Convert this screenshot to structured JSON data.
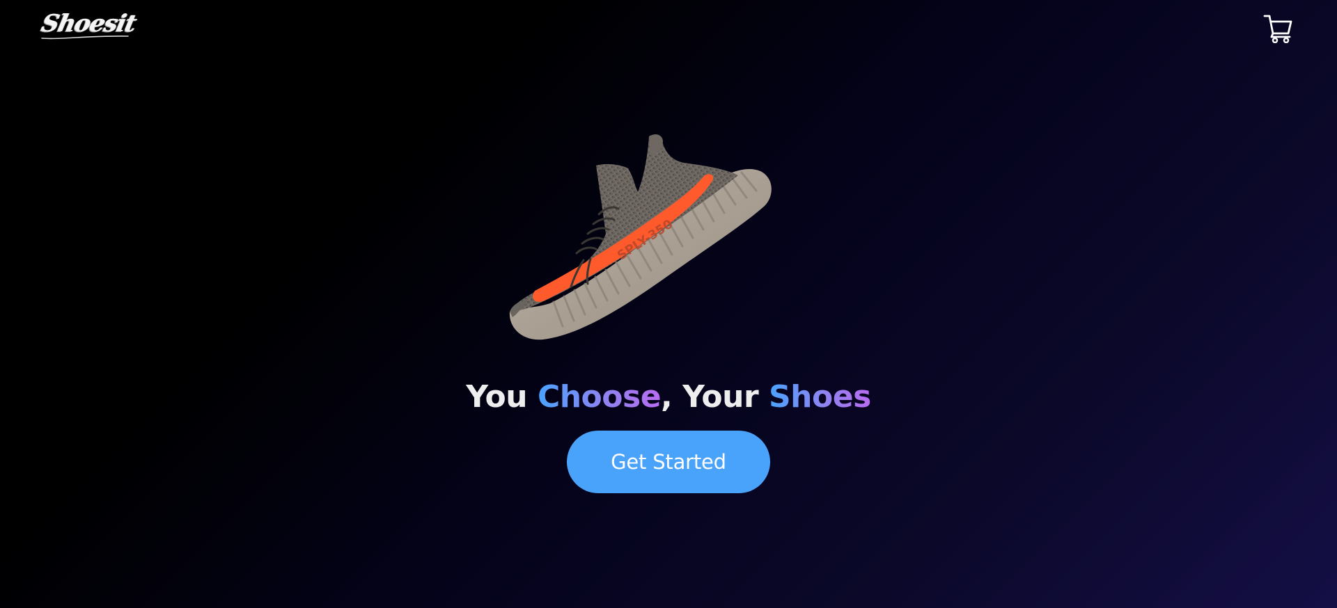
{
  "header": {
    "logo_text": "Shoesit",
    "cart_icon": "shopping-cart-icon"
  },
  "hero": {
    "image_icon": "sneaker-image",
    "shoe_tag_text": "SPLY-350",
    "headline": {
      "part1": "You ",
      "highlight1": "Choose",
      "part2": ", Your ",
      "highlight2": "Shoes"
    },
    "cta_label": "Get Started"
  },
  "colors": {
    "background_start": "#000000",
    "background_end": "#140f45",
    "accent_blue": "#4aa3fb",
    "gradient_purple": "#b86cf2",
    "shoe_stripe": "#ff5a2c"
  }
}
